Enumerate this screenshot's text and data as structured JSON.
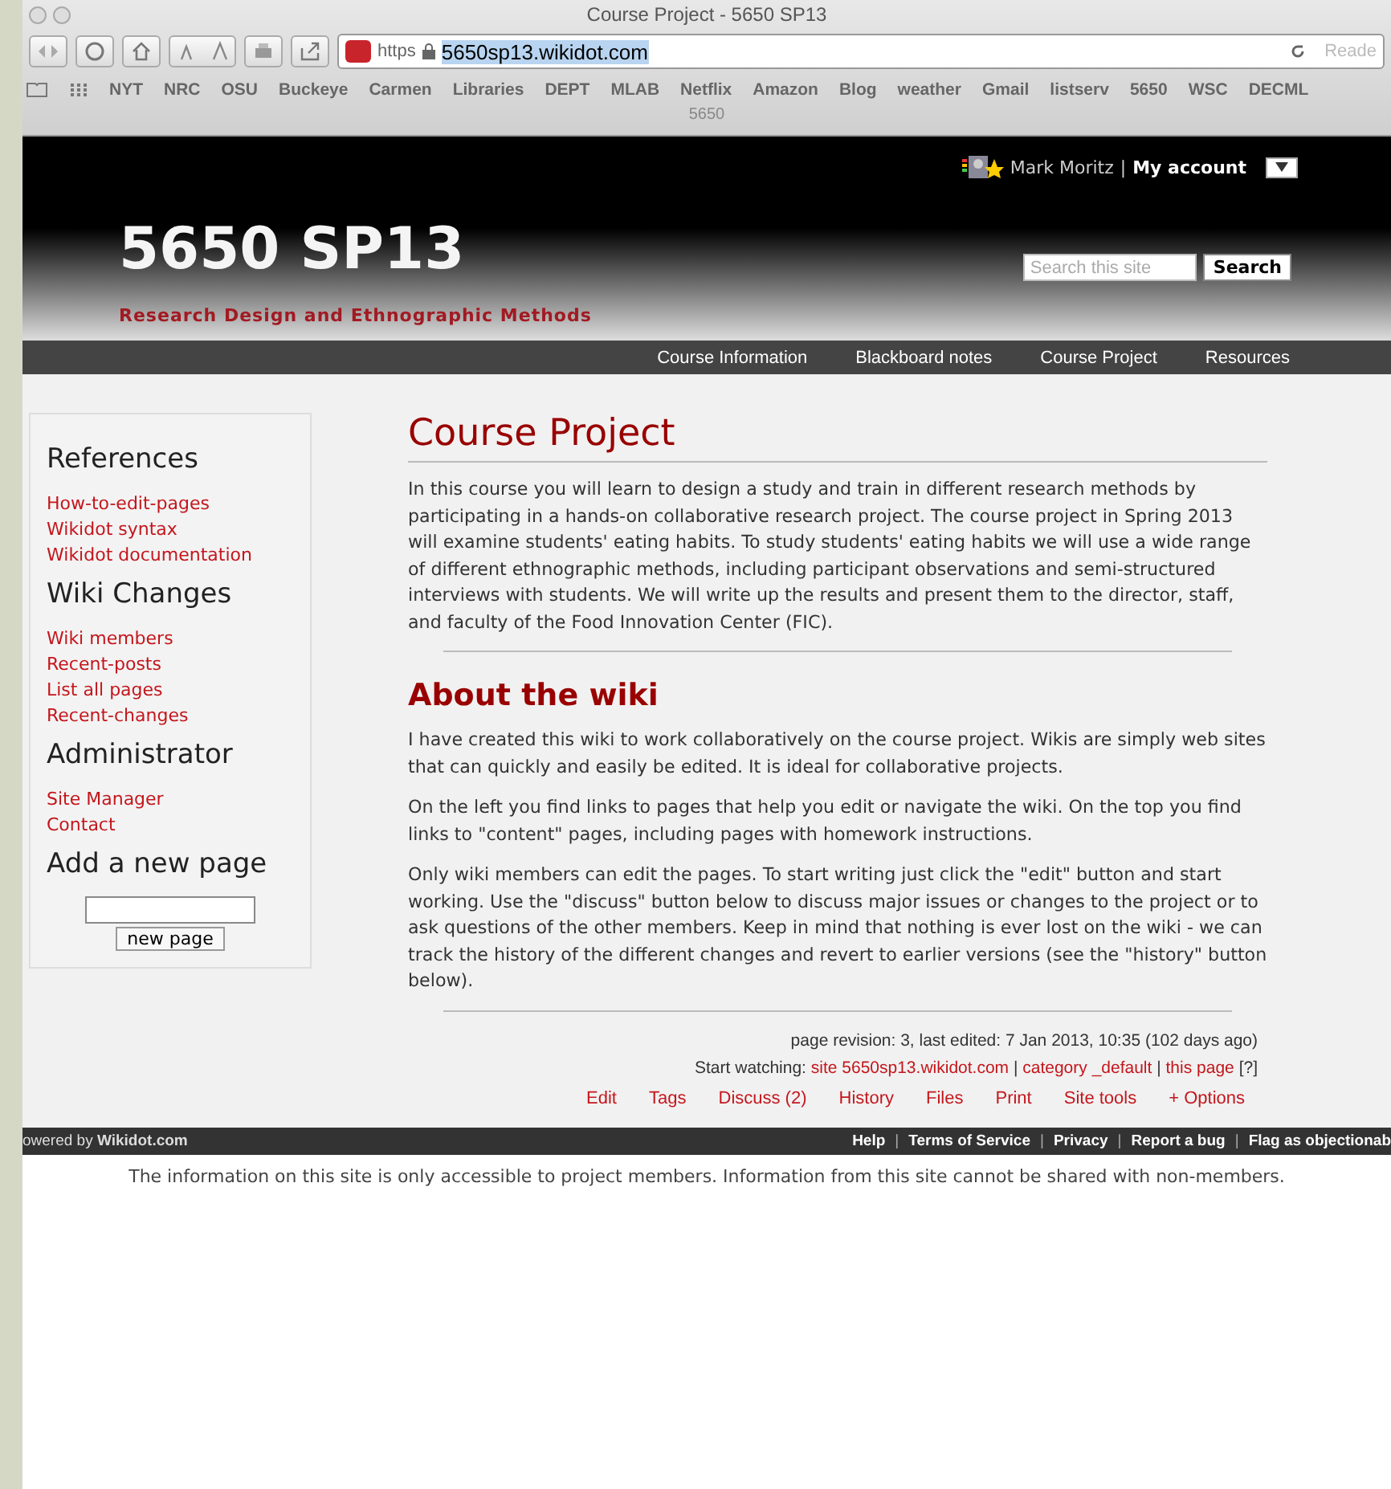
{
  "browser": {
    "title": "Course Project - 5650 SP13",
    "scheme": "https",
    "host": "5650sp13.wikidot.com",
    "reader": "Reade",
    "bookmarks": [
      "NYT",
      "NRC",
      "OSU",
      "Buckeye",
      "Carmen",
      "Libraries",
      "DEPT",
      "MLAB",
      "Netflix",
      "Amazon",
      "Blog",
      "weather",
      "Gmail",
      "listserv",
      "5650",
      "WSC",
      "DECML"
    ],
    "bookmark_overflow": "5650"
  },
  "header": {
    "user": {
      "name": "Mark Moritz",
      "separator": "|",
      "account": "My account"
    },
    "site_title": "5650 SP13",
    "subtitle": "Research Design and Ethnographic Methods",
    "search": {
      "placeholder": "Search this site",
      "button": "Search"
    }
  },
  "nav": [
    "Course Information",
    "Blackboard notes",
    "Course Project",
    "Resources"
  ],
  "sidebar": {
    "sections": [
      {
        "title": "References",
        "links": [
          "How-to-edit-pages",
          "Wikidot syntax",
          "Wikidot documentation"
        ]
      },
      {
        "title": "Wiki Changes",
        "links": [
          "Wiki members",
          "Recent-posts",
          "List all pages",
          "Recent-changes"
        ]
      },
      {
        "title": "Administrator",
        "links": [
          "Site Manager",
          "Contact"
        ]
      }
    ],
    "new_page": {
      "title": "Add a new page",
      "button": "new page"
    }
  },
  "main": {
    "title": "Course Project",
    "intro": "In this course you will learn to design a study and train in different research methods by participating in a hands-on collaborative research project. The course project in Spring 2013 will examine students' eating habits. To study students' eating habits we will use a wide range of different ethnographic methods, including participant observations and semi-structured interviews with students. We will write up the results and present them to the director, staff, and faculty of the Food Innovation Center (FIC).",
    "section": {
      "title": "About the wiki",
      "paragraphs": [
        "I have created this wiki to work collaboratively on the course project. Wikis are simply web sites that can quickly and easily be edited. It is ideal for collaborative projects.",
        "On the left you find links to pages that help you edit or navigate the wiki. On the top you find links to \"content\" pages, including pages with homework instructions.",
        "Only wiki members can edit the pages. To start writing just click the \"edit\" button and start working. Use the \"discuss\" button below to discuss major issues or changes to the project or to ask questions of the other members. Keep in mind that nothing is ever lost on the wiki - we can track the history of the different changes and revert to earlier versions (see the \"history\" button below)."
      ]
    }
  },
  "meta": {
    "revision": "page revision: 3, last edited: 7 Jan 2013, 10:35 (102 days ago)",
    "watching": {
      "label": "Start watching:",
      "links": [
        "site 5650sp13.wikidot.com",
        "category _default",
        "this page"
      ],
      "separators": [
        "|",
        "|"
      ],
      "help": "[?]"
    },
    "actions": [
      "Edit",
      "Tags",
      "Discuss (2)",
      "History",
      "Files",
      "Print",
      "Site tools",
      "+ Options"
    ]
  },
  "footer": {
    "powered_prefix": "owered by",
    "powered_brand": "Wikidot.com",
    "links": [
      "Help",
      "Terms of Service",
      "Privacy",
      "Report a bug",
      "Flag as objectionab"
    ],
    "separators": [
      "|",
      "|",
      "|",
      "|"
    ]
  },
  "notice": "The information on this site is only accessible to project members. Information from this site cannot be shared with non-members."
}
